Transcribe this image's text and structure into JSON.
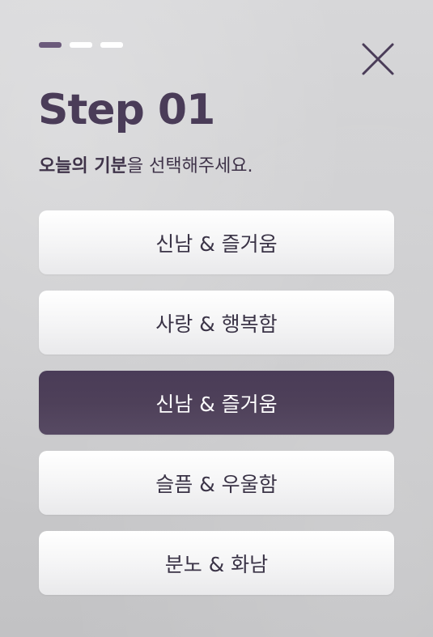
{
  "header": {
    "step_title": "Step 01",
    "subtitle_strong": "오늘의 기분",
    "subtitle_rest": "을 선택해주세요."
  },
  "stepper": {
    "total": 3,
    "current": 1
  },
  "options": [
    {
      "label": "신남 & 즐거움",
      "selected": false
    },
    {
      "label": "사랑 & 행복함",
      "selected": false
    },
    {
      "label": "신남 & 즐거움",
      "selected": true
    },
    {
      "label": "슬픔 & 우울함",
      "selected": false
    },
    {
      "label": "분노 & 화남",
      "selected": false
    }
  ],
  "icons": {
    "close": "close-icon"
  },
  "colors": {
    "accent": "#4a3c58",
    "stepper_active": "#6b5a7b",
    "stepper_inactive": "#ffffff",
    "option_bg": "#ffffff",
    "option_text": "#3a3346",
    "selected_text": "#ffffff"
  }
}
